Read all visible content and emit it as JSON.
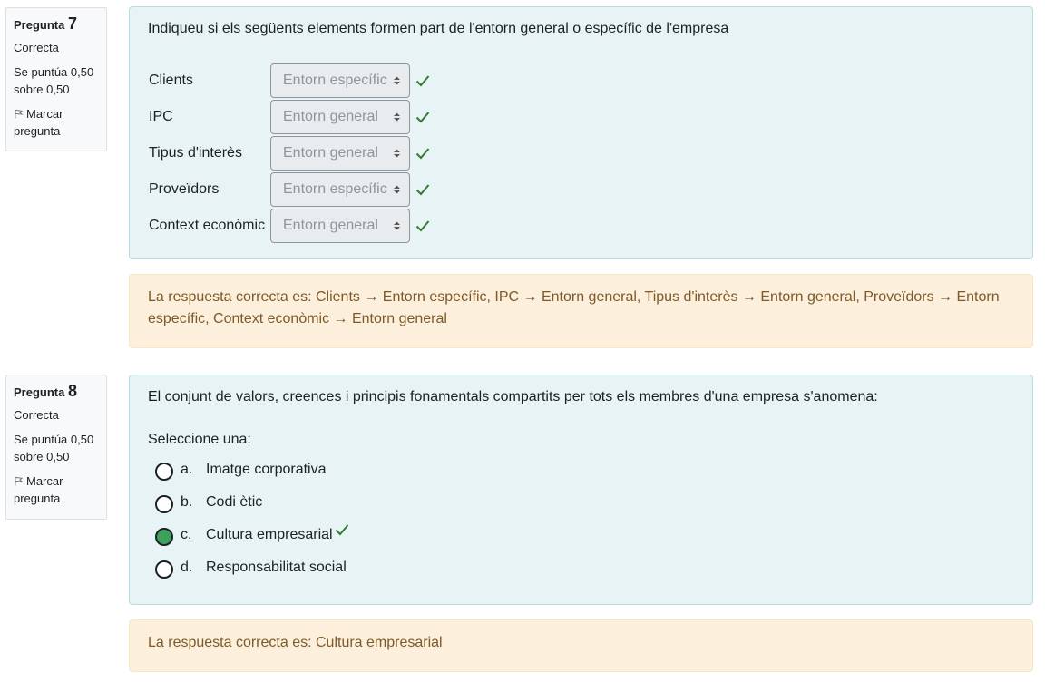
{
  "questions": [
    {
      "info": {
        "label": "Pregunta",
        "number": "7",
        "state": "Correcta",
        "grade_line1": "Se puntúa 0,50",
        "grade_line2": "sobre 0,50",
        "flag_line1": "Marcar",
        "flag_line2": "pregunta"
      },
      "text": "Indiqueu si els següents elements formen part de l'entorn general o específic de l'empresa",
      "rows": [
        {
          "label": "Clients",
          "selected": "Entorn específic",
          "correct": true
        },
        {
          "label": "IPC",
          "selected": "Entorn general",
          "correct": true
        },
        {
          "label": "Tipus d'interès",
          "selected": "Entorn general",
          "correct": true
        },
        {
          "label": "Proveïdors",
          "selected": "Entorn específic",
          "correct": true
        },
        {
          "label": "Context econòmic",
          "selected": "Entorn general",
          "correct": true
        }
      ],
      "feedback_line1": "La respuesta correcta es: Clients → Entorn específic, IPC → Entorn general, Tipus d'interès → Entorn general, Proveïdors → Entorn",
      "feedback_line2": "específic, Context econòmic → Entorn general"
    },
    {
      "info": {
        "label": "Pregunta",
        "number": "8",
        "state": "Correcta",
        "grade_line1": "Se puntúa 0,50",
        "grade_line2": "sobre 0,50",
        "flag_line1": "Marcar",
        "flag_line2": "pregunta"
      },
      "text": "El conjunt de valors, creences i principis fonamentals compartits per tots els membres d'una empresa s'anomena:",
      "prompt": "Seleccione una:",
      "options": [
        {
          "letter": "a.",
          "text": "Imatge corporativa",
          "checked": false
        },
        {
          "letter": "b.",
          "text": "Codi ètic",
          "checked": false
        },
        {
          "letter": "c.",
          "text": "Cultura empresarial",
          "checked": true,
          "correct": true
        },
        {
          "letter": "d.",
          "text": "Responsabilitat social",
          "checked": false
        }
      ],
      "feedback": "La respuesta correcta es: Cultura empresarial"
    }
  ],
  "colors": {
    "content_bg": "#e7f3f5",
    "feedback_bg": "#fcefdc",
    "feedback_text": "#7d5a29",
    "check": "#357a32",
    "radio_checked": "#3da15c"
  },
  "icons": {
    "flag": "flag-icon",
    "check": "check-icon",
    "select_caret": "caret-updown-icon"
  }
}
